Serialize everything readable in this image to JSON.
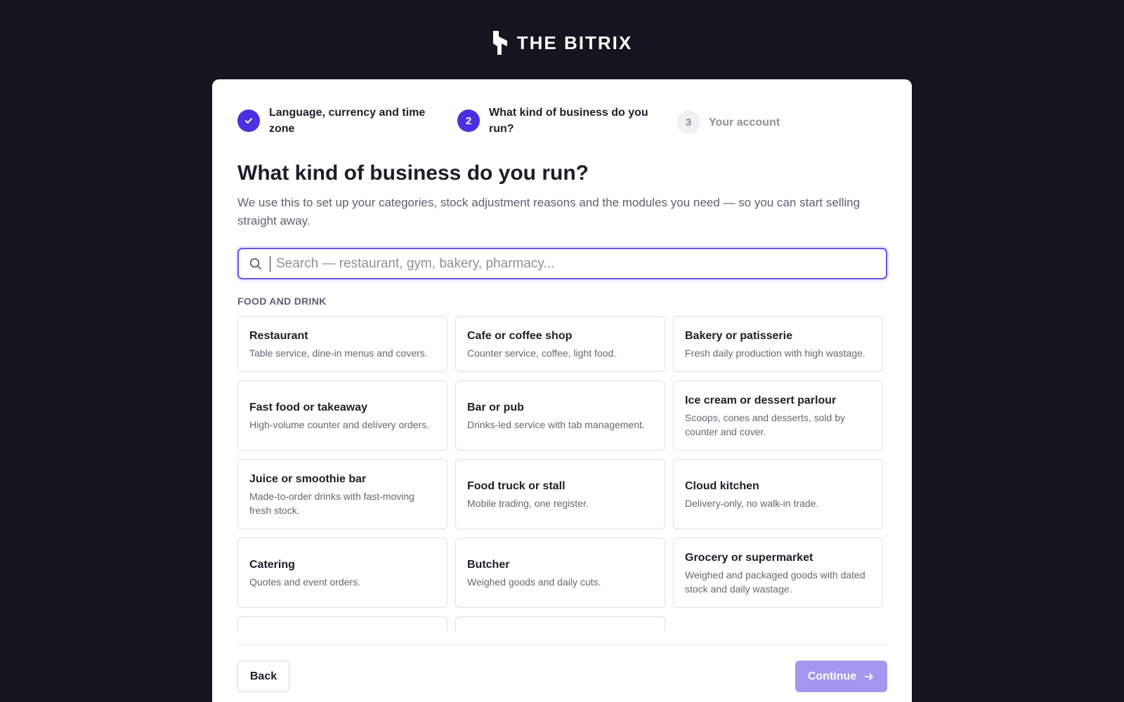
{
  "brand": {
    "name": "THE BITRIX"
  },
  "stepper": {
    "steps": [
      {
        "number": "",
        "label": "Language, currency and time zone",
        "state": "done"
      },
      {
        "number": "2",
        "label": "What kind of business do you run?",
        "state": "active"
      },
      {
        "number": "3",
        "label": "Your account",
        "state": "pending"
      }
    ]
  },
  "page": {
    "title": "What kind of business do you run?",
    "subtitle": "We use this to set up your categories, stock adjustment reasons and the modules you need — so you can start selling straight away."
  },
  "search": {
    "placeholder": "Search — restaurant, gym, bakery, pharmacy...",
    "value": ""
  },
  "sections": [
    {
      "label": "FOOD AND DRINK",
      "items": [
        {
          "title": "Restaurant",
          "desc": "Table service, dine-in menus and covers."
        },
        {
          "title": "Cafe or coffee shop",
          "desc": "Counter service, coffee, light food."
        },
        {
          "title": "Bakery or patisserie",
          "desc": "Fresh daily production with high wastage."
        },
        {
          "title": "Fast food or takeaway",
          "desc": "High-volume counter and delivery orders."
        },
        {
          "title": "Bar or pub",
          "desc": "Drinks-led service with tab management."
        },
        {
          "title": "Ice cream or dessert parlour",
          "desc": "Scoops, cones and desserts, sold by counter and cover."
        },
        {
          "title": "Juice or smoothie bar",
          "desc": "Made-to-order drinks with fast-moving fresh stock."
        },
        {
          "title": "Food truck or stall",
          "desc": "Mobile trading, one register."
        },
        {
          "title": "Cloud kitchen",
          "desc": "Delivery-only, no walk-in trade."
        },
        {
          "title": "Catering",
          "desc": "Quotes and event orders."
        },
        {
          "title": "Butcher",
          "desc": "Weighed goods and daily cuts."
        },
        {
          "title": "Grocery or supermarket",
          "desc": "Weighed and packaged goods with dated stock and daily wastage."
        }
      ]
    }
  ],
  "footer": {
    "back_label": "Back",
    "continue_label": "Continue"
  },
  "colors": {
    "accent": "#4c2fe0",
    "continue_disabled": "#a596f0",
    "background": "#13151f"
  }
}
